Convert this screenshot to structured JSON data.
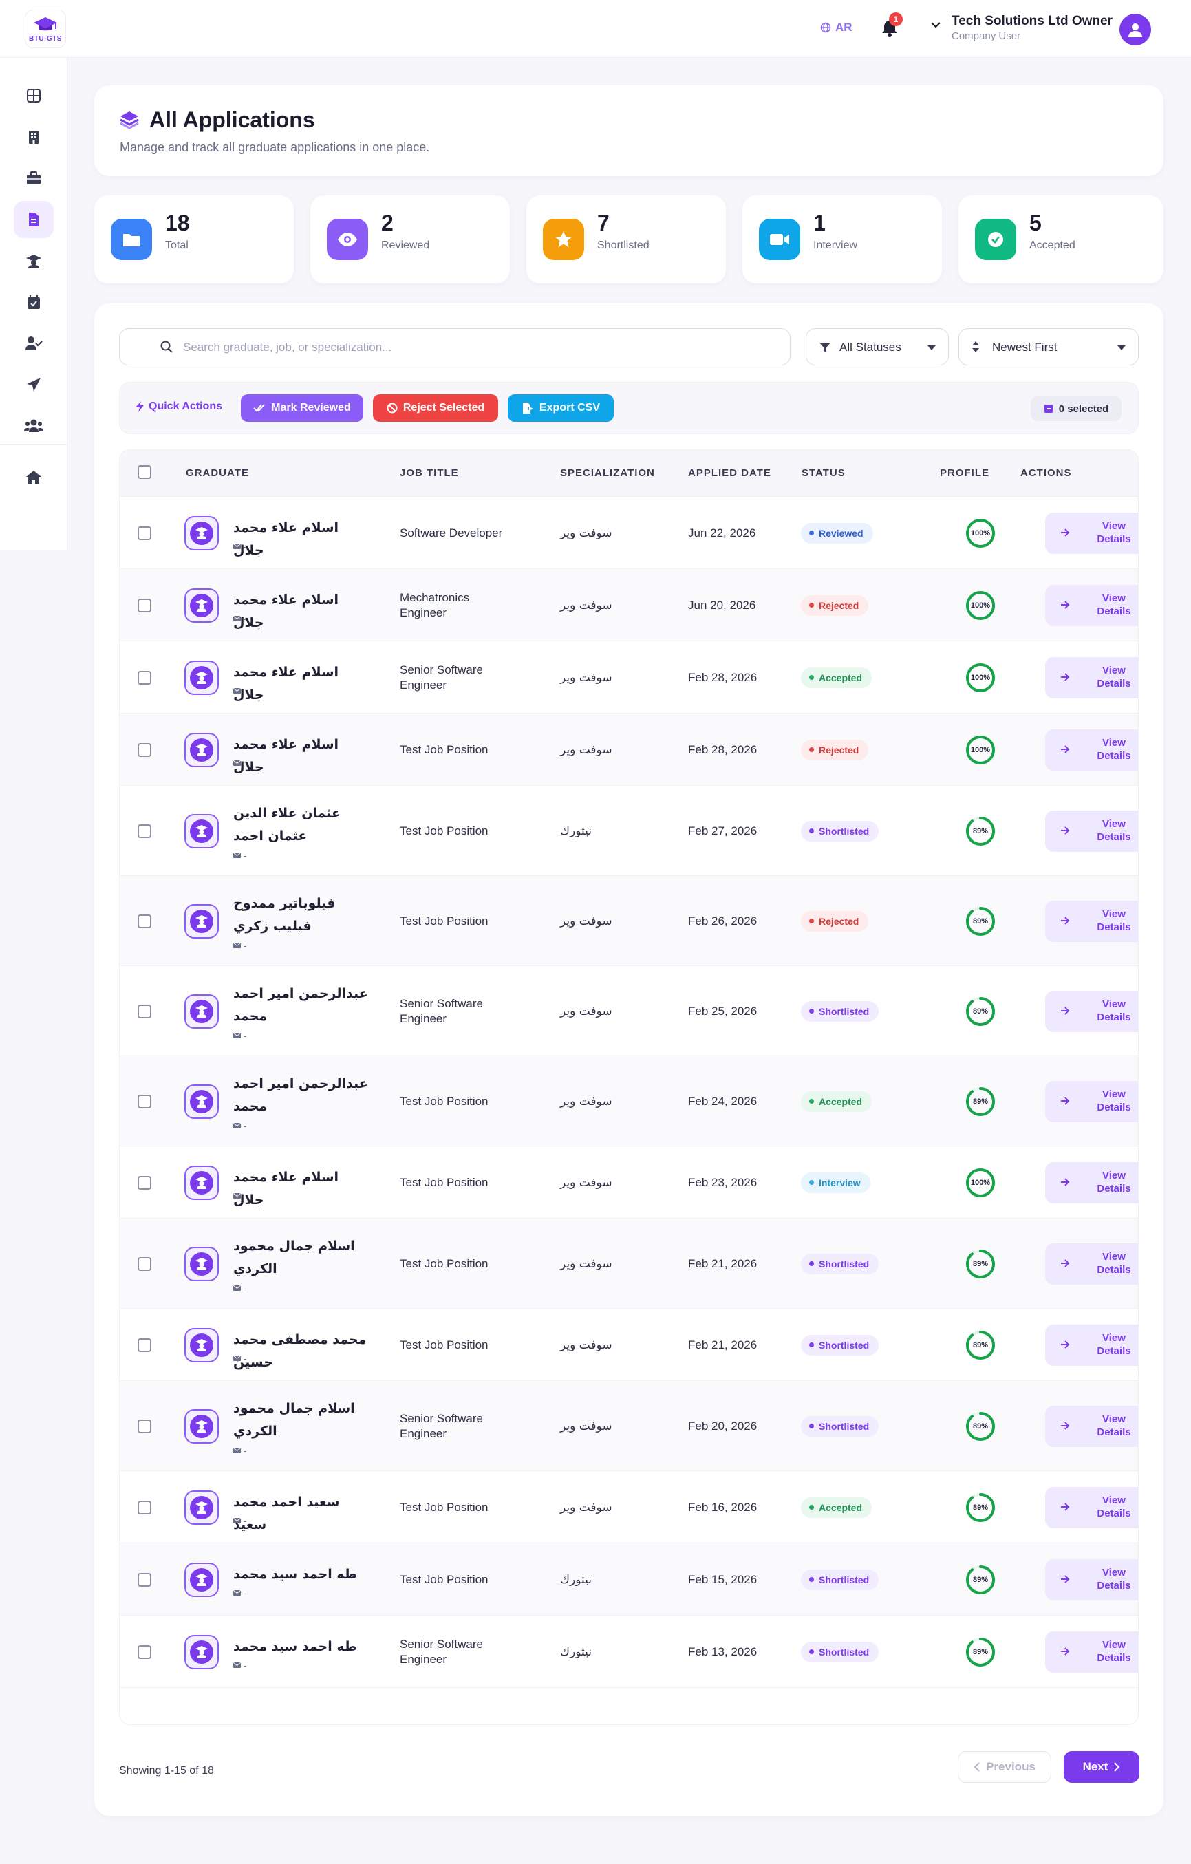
{
  "app": {
    "logo_text": "BTU-GTS"
  },
  "header": {
    "lang": "AR",
    "notifications_count": "1",
    "user_name": "Tech Solutions Ltd Owner",
    "user_role": "Company User"
  },
  "sidebar": {
    "items": [
      {
        "icon": "dashboard-icon",
        "active": false
      },
      {
        "icon": "building-icon",
        "active": false
      },
      {
        "icon": "briefcase-icon",
        "active": false
      },
      {
        "icon": "document-icon",
        "active": true
      },
      {
        "icon": "graduate-icon",
        "active": false
      },
      {
        "icon": "calendar-check-icon",
        "active": false
      },
      {
        "icon": "user-check-icon",
        "active": false
      },
      {
        "icon": "send-icon",
        "active": false
      },
      {
        "icon": "users-icon",
        "active": false
      },
      {
        "icon": "home-icon",
        "active": false
      }
    ]
  },
  "page": {
    "title": "All Applications",
    "subtitle": "Manage and track all graduate applications in one place."
  },
  "stats": [
    {
      "value": "18",
      "label": "Total",
      "color": "#3b82f6",
      "icon": "folder-icon"
    },
    {
      "value": "2",
      "label": "Reviewed",
      "color": "#8b5cf6",
      "icon": "eye-icon"
    },
    {
      "value": "7",
      "label": "Shortlisted",
      "color": "#f59e0b",
      "icon": "star-icon"
    },
    {
      "value": "1",
      "label": "Interview",
      "color": "#0ea5e9",
      "icon": "video-icon"
    },
    {
      "value": "5",
      "label": "Accepted",
      "color": "#10b981",
      "icon": "check-circle-icon"
    }
  ],
  "filters": {
    "search_placeholder": "Search graduate, job, or specialization...",
    "status": "All Statuses",
    "sort": "Newest First"
  },
  "quick_actions": {
    "label": "Quick Actions",
    "mark_reviewed": "Mark Reviewed",
    "reject_selected": "Reject Selected",
    "export_csv": "Export CSV",
    "selected": "0 selected"
  },
  "table": {
    "columns": [
      "GRADUATE",
      "JOB TITLE",
      "SPECIALIZATION",
      "APPLIED DATE",
      "STATUS",
      "PROFILE",
      "ACTIONS"
    ],
    "view_label": "View Details",
    "rows": [
      {
        "name": "اسلام علاء محمد جلال",
        "email": "-",
        "job": "Software Developer",
        "spec": "سوفت وير",
        "date": "Jun 22, 2026",
        "status": "Reviewed",
        "profile": "100%",
        "pct": 100
      },
      {
        "name": "اسلام علاء محمد جلال",
        "email": "-",
        "job": "Mechatronics Engineer",
        "spec": "سوفت وير",
        "date": "Jun 20, 2026",
        "status": "Rejected",
        "profile": "100%",
        "pct": 100
      },
      {
        "name": "اسلام علاء محمد جلال",
        "email": "-",
        "job": "Senior Software Engineer",
        "spec": "سوفت وير",
        "date": "Feb 28, 2026",
        "status": "Accepted",
        "profile": "100%",
        "pct": 100
      },
      {
        "name": "اسلام علاء محمد جلال",
        "email": "-",
        "job": "Test Job Position",
        "spec": "سوفت وير",
        "date": "Feb 28, 2026",
        "status": "Rejected",
        "profile": "100%",
        "pct": 100
      },
      {
        "name": "عثمان علاء الدين عثمان احمد",
        "email": "-",
        "job": "Test Job Position",
        "spec": "نيتورك",
        "date": "Feb 27, 2026",
        "status": "Shortlisted",
        "profile": "89%",
        "pct": 89
      },
      {
        "name": "فيلوباتير ممدوح فيليب زكري",
        "email": "-",
        "job": "Test Job Position",
        "spec": "سوفت وير",
        "date": "Feb 26, 2026",
        "status": "Rejected",
        "profile": "89%",
        "pct": 89
      },
      {
        "name": "عبدالرحمن امير احمد محمد",
        "email": "-",
        "job": "Senior Software Engineer",
        "spec": "سوفت وير",
        "date": "Feb 25, 2026",
        "status": "Shortlisted",
        "profile": "89%",
        "pct": 89
      },
      {
        "name": "عبدالرحمن امير احمد محمد",
        "email": "-",
        "job": "Test Job Position",
        "spec": "سوفت وير",
        "date": "Feb 24, 2026",
        "status": "Accepted",
        "profile": "89%",
        "pct": 89
      },
      {
        "name": "اسلام علاء محمد جلال",
        "email": "-",
        "job": "Test Job Position",
        "spec": "سوفت وير",
        "date": "Feb 23, 2026",
        "status": "Interview",
        "profile": "100%",
        "pct": 100
      },
      {
        "name": "اسلام جمال محمود الكردي",
        "email": "-",
        "job": "Test Job Position",
        "spec": "سوفت وير",
        "date": "Feb 21, 2026",
        "status": "Shortlisted",
        "profile": "89%",
        "pct": 89
      },
      {
        "name": "محمد مصطفى محمد حسين",
        "email": "-",
        "job": "Test Job Position",
        "spec": "سوفت وير",
        "date": "Feb 21, 2026",
        "status": "Shortlisted",
        "profile": "89%",
        "pct": 89
      },
      {
        "name": "اسلام جمال محمود الكردي",
        "email": "-",
        "job": "Senior Software Engineer",
        "spec": "سوفت وير",
        "date": "Feb 20, 2026",
        "status": "Shortlisted",
        "profile": "89%",
        "pct": 89
      },
      {
        "name": "سعيد احمد محمد سعيد",
        "email": "-",
        "job": "Test Job Position",
        "spec": "سوفت وير",
        "date": "Feb 16, 2026",
        "status": "Accepted",
        "profile": "89%",
        "pct": 89
      },
      {
        "name": "طه احمد سيد محمد",
        "email": "-",
        "job": "Test Job Position",
        "spec": "نيتورك",
        "date": "Feb 15, 2026",
        "status": "Shortlisted",
        "profile": "89%",
        "pct": 89
      },
      {
        "name": "طه احمد سيد محمد",
        "email": "-",
        "job": "Senior Software Engineer",
        "spec": "نيتورك",
        "date": "Feb 13, 2026",
        "status": "Shortlisted",
        "profile": "89%",
        "pct": 89
      }
    ]
  },
  "pagination": {
    "showing": "Showing 1-15 of 18",
    "previous": "Previous",
    "next": "Next"
  }
}
